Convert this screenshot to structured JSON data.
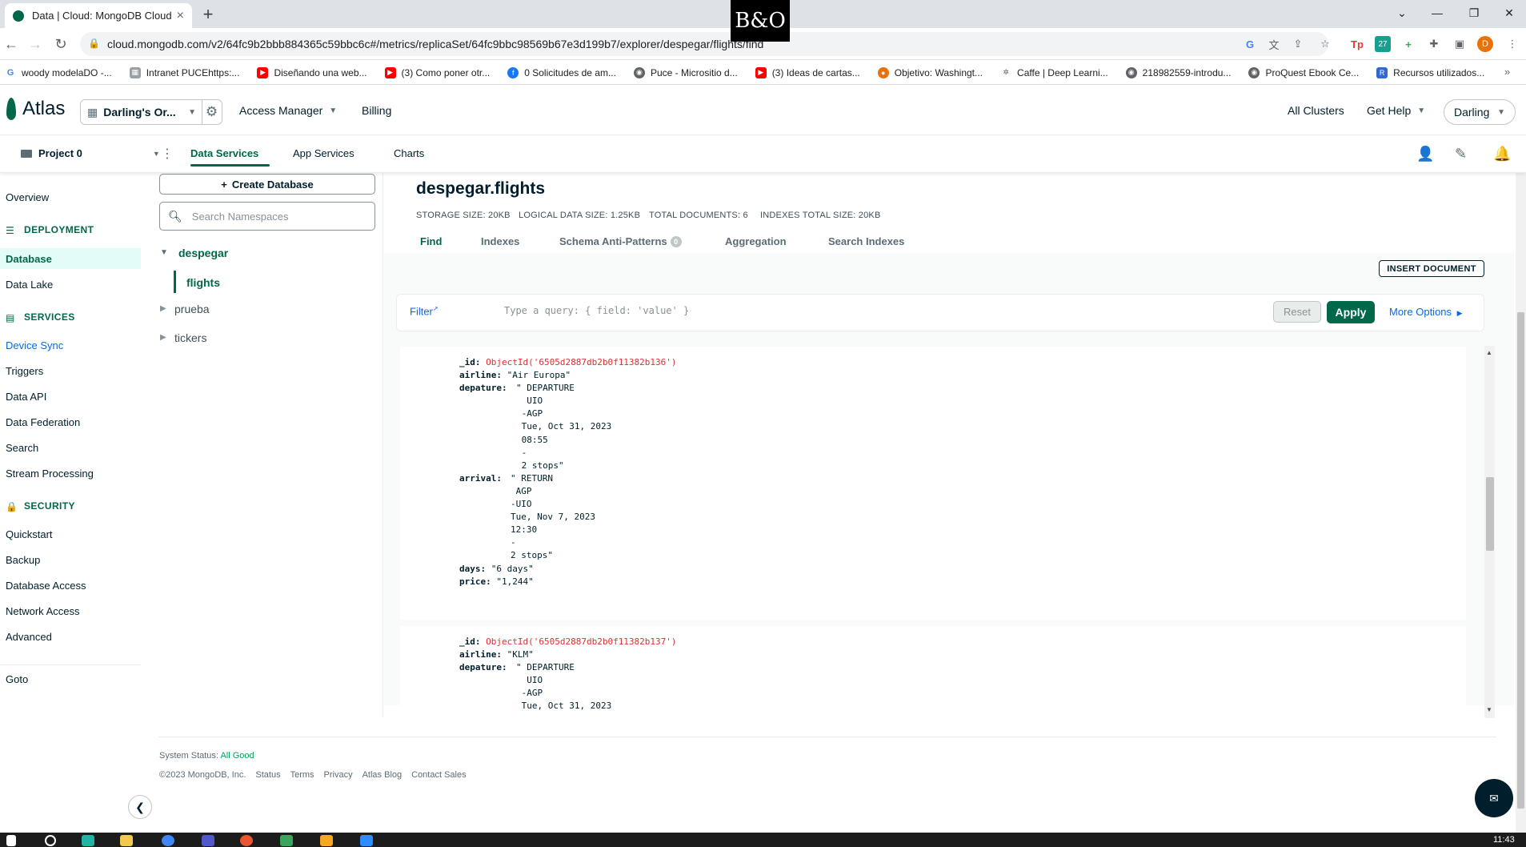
{
  "browser": {
    "tab_title": "Data | Cloud: MongoDB Cloud",
    "url": "cloud.mongodb.com/v2/64fc9b2bbb884365c59bbc6c#/metrics/replicaSet/64fc9bbc98569b67e3d199b7/explorer/despegar/flights/find",
    "bo_logo": "B&O",
    "profile_initial": "D",
    "bookmarks": [
      "woody modelaDO -...",
      "Intranet PUCEhttps:...",
      "Diseñando una web...",
      "(3) Como poner otr...",
      "0 Solicitudes de am...",
      "Puce - Micrositio d...",
      "(3) Ideas de cartas...",
      "Objetivo: Washingt...",
      "Caffe | Deep Learni...",
      "218982559-introdu...",
      "ProQuest Ebook Ce...",
      "Recursos utilizados..."
    ]
  },
  "atlas": {
    "logo_text": "Atlas",
    "org_name": "Darling's Or...",
    "access_manager": "Access Manager",
    "billing": "Billing",
    "all_clusters": "All Clusters",
    "get_help": "Get Help",
    "user": "Darling"
  },
  "project_nav": {
    "project": "Project 0",
    "tabs": [
      "Data Services",
      "App Services",
      "Charts"
    ]
  },
  "sidebar": {
    "overview": "Overview",
    "deployment_header": "DEPLOYMENT",
    "database": "Database",
    "data_lake": "Data Lake",
    "services_header": "SERVICES",
    "device_sync": "Device Sync",
    "triggers": "Triggers",
    "data_api": "Data API",
    "data_federation": "Data Federation",
    "search": "Search",
    "stream_processing": "Stream Processing",
    "security_header": "SECURITY",
    "quickstart": "Quickstart",
    "backup": "Backup",
    "database_access": "Database Access",
    "network_access": "Network Access",
    "advanced": "Advanced",
    "goto": "Goto"
  },
  "namespaces": {
    "create_db": "Create Database",
    "search_placeholder": "Search Namespaces",
    "db_open": "despegar",
    "collection_active": "flights",
    "db_2": "prueba",
    "db_3": "tickers"
  },
  "collection": {
    "title": "despegar.flights",
    "storage_size": "STORAGE SIZE: 20KB",
    "logical_size": "LOGICAL DATA SIZE: 1.25KB",
    "total_docs": "TOTAL DOCUMENTS: 6",
    "indexes_size": "INDEXES TOTAL SIZE: 20KB",
    "tabs": [
      "Find",
      "Indexes",
      "Schema Anti-Patterns",
      "Aggregation",
      "Search Indexes"
    ],
    "schema_badge": "0",
    "insert_document": "INSERT DOCUMENT",
    "filter_label": "Filter",
    "filter_placeholder": "Type a query: { field: 'value' }",
    "reset": "Reset",
    "apply": "Apply",
    "more_options": "More Options"
  },
  "documents": [
    {
      "id_key": "_id:",
      "id_val": "ObjectId('6505d2887db2b0f11382b136')",
      "airline_key": "airline:",
      "airline_val": "\"Air Europa\"",
      "depature_key": "depature:",
      "depature_val": "\" DEPARTURE\n  UIO\n -AGP\n Tue, Oct 31, 2023\n 08:55\n -\n 2 stops\"",
      "arrival_key": "arrival:",
      "arrival_val": "\" RETURN\n AGP\n-UIO\nTue, Nov 7, 2023\n12:30\n-\n2 stops\"",
      "days_key": "days:",
      "days_val": "\"6 days\"",
      "price_key": "price:",
      "price_val": "\"1,244\""
    },
    {
      "id_key": "_id:",
      "id_val": "ObjectId('6505d2887db2b0f11382b137')",
      "airline_key": "airline:",
      "airline_val": "\"KLM\"",
      "depature_key": "depature:",
      "depature_val": "\" DEPARTURE\n  UIO\n -AGP\n Tue, Oct 31, 2023"
    }
  ],
  "footer": {
    "system_status": "System Status:",
    "status_value": "All Good",
    "copyright": "©2023 MongoDB, Inc.",
    "links": [
      "Status",
      "Terms",
      "Privacy",
      "Atlas Blog",
      "Contact Sales"
    ]
  },
  "taskbar": {
    "clock": "11:43"
  }
}
